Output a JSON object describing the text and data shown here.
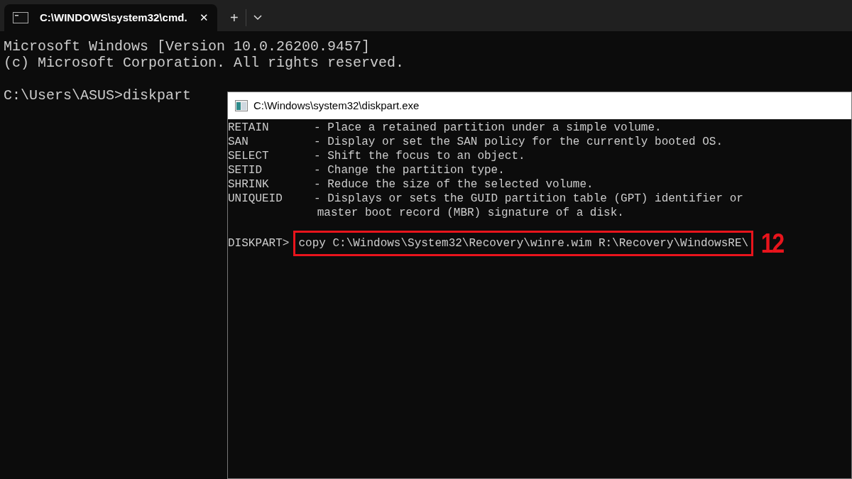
{
  "tab": {
    "title": "C:\\WINDOWS\\system32\\cmd.",
    "selected": true,
    "close": "✕"
  },
  "tab_actions": {
    "new_tab": "+"
  },
  "terminal": {
    "lines": [
      "Microsoft Windows [Version 10.0.26200.9457]",
      "(c) Microsoft Corporation. All rights reserved."
    ],
    "prompt_line": "C:\\Users\\ASUS>diskpart"
  },
  "diskpart_window": {
    "title": "C:\\Windows\\system32\\diskpart.exe",
    "commands": [
      {
        "name": "RETAIN",
        "description": [
          "- Place a retained partition under a simple volume."
        ]
      },
      {
        "name": "SAN",
        "description": [
          "- Display or set the SAN policy for the currently booted OS."
        ]
      },
      {
        "name": "SELECT",
        "description": [
          "- Shift the focus to an object."
        ]
      },
      {
        "name": "SETID",
        "description": [
          "- Change the partition type."
        ]
      },
      {
        "name": "SHRINK",
        "description": [
          "- Reduce the size of the selected volume."
        ]
      },
      {
        "name": "UNIQUEID",
        "description": [
          "- Displays or sets the GUID partition table (GPT) identifier or",
          "master boot record (MBR) signature of a disk."
        ]
      }
    ],
    "prompt": "DISKPART>",
    "command": "copy C:\\Windows\\System32\\Recovery\\winre.wim R:\\Recovery\\WindowsRE\\",
    "annotation": {
      "step": "12"
    }
  }
}
